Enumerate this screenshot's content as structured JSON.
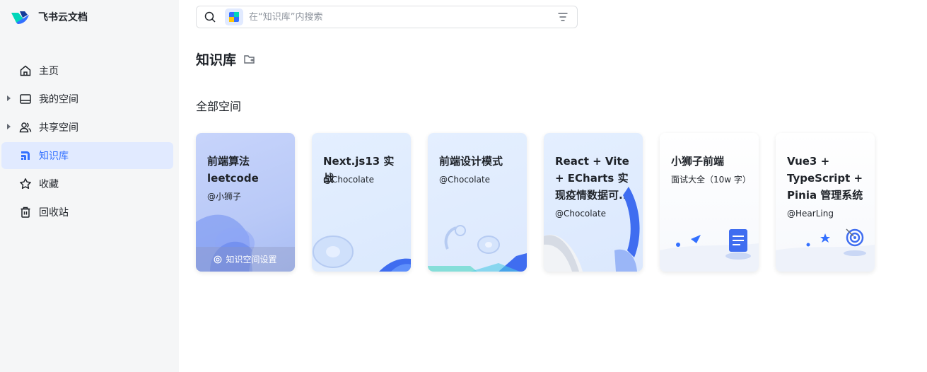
{
  "app": {
    "name": "飞书云文档"
  },
  "sidebar": {
    "items": [
      {
        "label": "主页",
        "icon": "home-icon"
      },
      {
        "label": "我的空间",
        "icon": "folder-icon"
      },
      {
        "label": "共享空间",
        "icon": "users-icon"
      },
      {
        "label": "知识库",
        "icon": "wiki-icon",
        "active": true
      },
      {
        "label": "收藏",
        "icon": "star-icon"
      },
      {
        "label": "回收站",
        "icon": "trash-icon"
      }
    ]
  },
  "search": {
    "placeholder": "在“知识库”内搜索"
  },
  "page": {
    "title": "知识库",
    "section": "全部空间"
  },
  "cards": [
    {
      "title": "前端算法 leetcode",
      "subtitle": "@小狮子",
      "hover_action": "知识空间设置"
    },
    {
      "title": "Next.js13 实战",
      "subtitle": "@Chocolate"
    },
    {
      "title": "前端设计模式",
      "subtitle": "@Chocolate"
    },
    {
      "title": "React + Vite + ECharts 实现疫情数据可...",
      "subtitle": "@Chocolate"
    },
    {
      "title": "小狮子前端",
      "subtitle": "面试大全（10w 字）"
    },
    {
      "title": "Vue3 + TypeScript + Pinia 管理系统",
      "subtitle": "@HearLing"
    }
  ],
  "colors": {
    "accent": "#3370ff",
    "active_bg": "#e1eaff",
    "sidebar_bg": "#f5f6f7"
  }
}
